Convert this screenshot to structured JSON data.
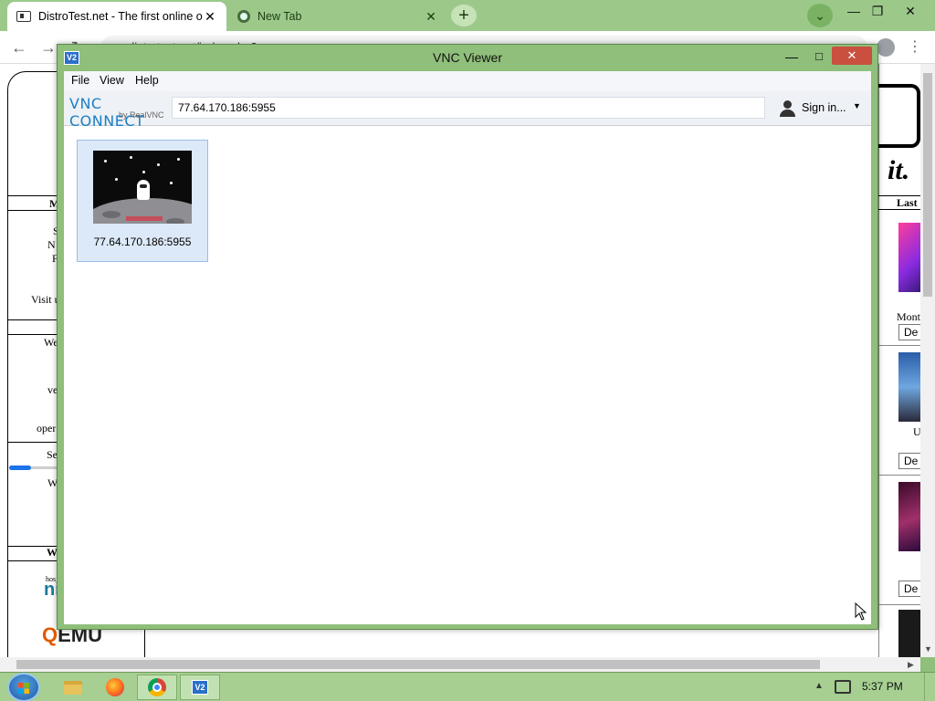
{
  "browser": {
    "tabs": [
      {
        "title": "DistroTest.net - The first online o",
        "active": true
      },
      {
        "title": "New Tab",
        "active": false
      }
    ],
    "new_tab_symbol": "+",
    "tab_close_symbol": "✕",
    "window_controls": {
      "minimize": "—",
      "maximize": "❐",
      "close": "✕"
    },
    "toolbar": {
      "back": "←",
      "forward": "→",
      "menu": "⋮"
    },
    "address_fragment": "distrotest.net/index.php?...",
    "accent_color": "#9cc98a"
  },
  "webpage": {
    "left_fragments": [
      "M",
      "S",
      "N",
      "F",
      "Visit u",
      "We",
      "ve",
      "oper",
      "Se",
      "W",
      "W",
      "hos"
    ],
    "host_logo": "ni",
    "qemu_logo": {
      "q": "Q",
      "rest": "EMU"
    },
    "right_logo": "it.",
    "right_header": "Last",
    "right_fragments": [
      "Mont",
      "U"
    ],
    "download_buttons": [
      "De",
      "De",
      "De"
    ]
  },
  "vnc": {
    "window_title": "VNC Viewer",
    "app_icon": "V2",
    "controls": {
      "minimize": "—",
      "maximize": "□",
      "close": "✕"
    },
    "menu": [
      "File",
      "View",
      "Help"
    ],
    "logo": {
      "main": "VNC CONNECT",
      "sub": "by RealVNC"
    },
    "address_value": "77.64.170.186:5955",
    "signin_label": "Sign in...",
    "connections": [
      {
        "label": "77.64.170.186:5955",
        "selected": true
      }
    ],
    "selection_color": "#dce9f8"
  },
  "taskbar": {
    "items": [
      "file-explorer",
      "firefox",
      "chrome",
      "vnc-viewer"
    ],
    "active_item": "vnc-viewer",
    "vnc_icon_text": "V2",
    "tray_up": "▲",
    "clock": "5:37 PM"
  }
}
